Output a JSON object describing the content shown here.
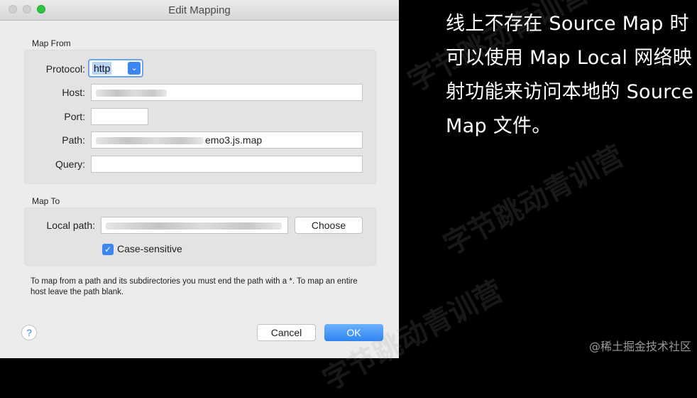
{
  "dialog": {
    "title": "Edit Mapping",
    "map_from": {
      "section_label": "Map From",
      "protocol_label": "Protocol:",
      "protocol_value": "http",
      "host_label": "Host:",
      "host_value": "",
      "port_label": "Port:",
      "port_value": "",
      "path_label": "Path:",
      "path_value_visible_suffix": "emo3.js.map",
      "query_label": "Query:",
      "query_value": ""
    },
    "map_to": {
      "section_label": "Map To",
      "local_path_label": "Local path:",
      "local_path_value": "",
      "choose_label": "Choose",
      "case_sensitive_label": "Case-sensitive",
      "case_sensitive_checked": true
    },
    "note": "To map from a path and its subdirectories you must end the path with a *. To map an entire host leave the path blank.",
    "help_label": "?",
    "cancel_label": "Cancel",
    "ok_label": "OK"
  },
  "caption": "线上不存在 Source Map 时可以使用 Map Local 网络映射功能来访问本地的 Source Map 文件。",
  "watermark": "字节跳动青训营",
  "credit": "@稀土掘金技术社区",
  "colors": {
    "accent": "#3b86f0",
    "dialog_bg": "#ececec",
    "backdrop": "#000000"
  },
  "icons": {
    "protocol_caret": "chevron-down-icon",
    "checkbox": "checkmark-icon",
    "help": "question-icon"
  }
}
